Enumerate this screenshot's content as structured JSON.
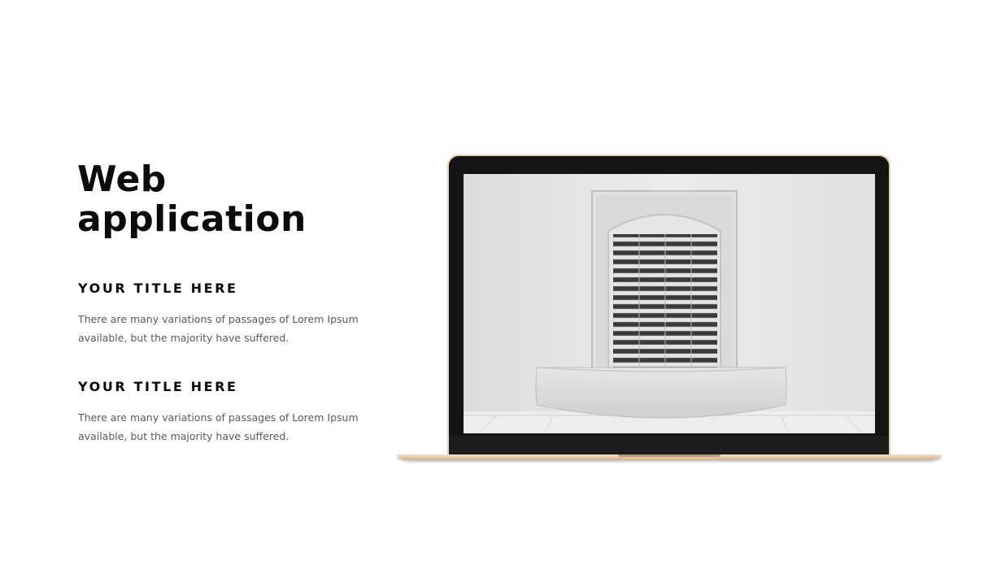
{
  "slide": {
    "title_line1": "Web",
    "title_line2": "application",
    "sections": [
      {
        "heading": "YOUR TITLE HERE",
        "body": "There are many variations of passages of Lorem Ipsum available, but the majority have suffered."
      },
      {
        "heading": "YOUR TITLE HERE",
        "body": "There are many variations of passages of Lorem Ipsum available, but the majority have suffered."
      }
    ]
  },
  "laptop": {
    "frame_color": "#e8cfae",
    "bezel_color": "#141414",
    "screen_image": "white-wall-shuttered-window-photo"
  }
}
